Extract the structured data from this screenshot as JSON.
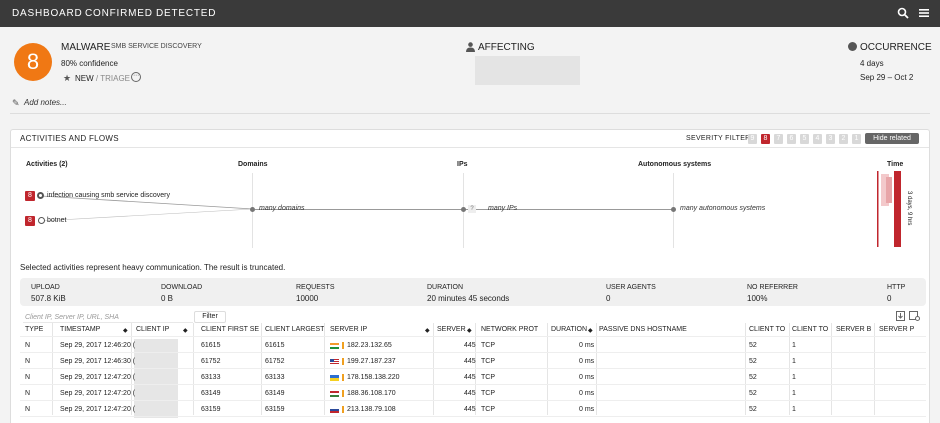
{
  "nav": {
    "tabs": [
      "DASHBOARD",
      "CONFIRMED",
      "DETECTED"
    ]
  },
  "header": {
    "risk_score": "8",
    "category": "MALWARE",
    "category_sub": "SMB SERVICE DISCOVERY",
    "confidence": "80% confidence",
    "status_new": "NEW",
    "status_sep": "/",
    "status_triage": "TRIAGE",
    "more_label": "⋯",
    "affecting_label": "AFFECTING",
    "occurrence_label": "OCCURRENCE",
    "occurrence_days": "4 days",
    "occurrence_range": "Sep 29 – Oct 2",
    "add_notes": "Add notes..."
  },
  "panel": {
    "title": "ACTIVITIES AND FLOWS",
    "severity_label": "SEVERITY FILTER:",
    "severity_levels": [
      "9",
      "8",
      "7",
      "6",
      "5",
      "4",
      "3",
      "2",
      "1"
    ],
    "severity_active": "8",
    "hide_related": "Hide related",
    "columns": {
      "activities": "Activities (2)",
      "domains": "Domains",
      "ips": "IPs",
      "asys": "Autonomous systems",
      "time": "Time"
    },
    "activities": [
      {
        "score": "8",
        "label": "infection causing smb service discovery",
        "selected": true
      },
      {
        "score": "8",
        "label": "botnet",
        "selected": false
      }
    ],
    "flow": {
      "domains": "many domains",
      "ip_count": "?",
      "ips": "many IPs",
      "asys": "many autonomous systems"
    },
    "time_label": "3 days, 9 hrs",
    "truncated_msg": "Selected activities represent heavy communication. The result is truncated."
  },
  "summary": [
    {
      "label": "UPLOAD",
      "value": "507.8 KiB"
    },
    {
      "label": "DOWNLOAD",
      "value": "0 B"
    },
    {
      "label": "REQUESTS",
      "value": "10000"
    },
    {
      "label": "DURATION",
      "value": "20 minutes 45 seconds"
    },
    {
      "label": "USER AGENTS",
      "value": "0"
    },
    {
      "label": "NO REFERRER",
      "value": "100%"
    },
    {
      "label": "HTTP",
      "value": "0"
    }
  ],
  "filter": {
    "placeholder": "Client IP, Server IP, URL, SHA",
    "button": "Filter"
  },
  "table": {
    "headers": [
      "TYPE",
      "TIMESTAMP",
      "CLIENT IP",
      "CLIENT FIRST SE",
      "CLIENT LARGEST",
      "SERVER IP",
      "SERVER",
      "NETWORK PROT",
      "DURATION",
      "PASSIVE DNS HOSTNAME",
      "CLIENT TO",
      "CLIENT TO",
      "SERVER B",
      "SERVER P"
    ],
    "rows": [
      {
        "type": "N",
        "timestamp": "Sep 29, 2017 12:46:20 (",
        "first": "61615",
        "largest": "61615",
        "flag": "in",
        "server_ip": "182.23.132.65",
        "port": "445",
        "proto": "TCP",
        "duration": "0 ms",
        "c1": "52",
        "c2": "1"
      },
      {
        "type": "N",
        "timestamp": "Sep 29, 2017 12:46:30 (",
        "first": "61752",
        "largest": "61752",
        "flag": "us",
        "server_ip": "199.27.187.237",
        "port": "445",
        "proto": "TCP",
        "duration": "0 ms",
        "c1": "52",
        "c2": "1"
      },
      {
        "type": "N",
        "timestamp": "Sep 29, 2017 12:47:20 (",
        "first": "63133",
        "largest": "63133",
        "flag": "ua",
        "server_ip": "178.158.138.220",
        "port": "445",
        "proto": "TCP",
        "duration": "0 ms",
        "c1": "52",
        "c2": "1"
      },
      {
        "type": "N",
        "timestamp": "Sep 29, 2017 12:47:20 (",
        "first": "63149",
        "largest": "63149",
        "flag": "hu",
        "server_ip": "188.36.108.170",
        "port": "445",
        "proto": "TCP",
        "duration": "0 ms",
        "c1": "52",
        "c2": "1"
      },
      {
        "type": "N",
        "timestamp": "Sep 29, 2017 12:47:20 (",
        "first": "63159",
        "largest": "63159",
        "flag": "ru",
        "server_ip": "213.138.79.108",
        "port": "445",
        "proto": "TCP",
        "duration": "0 ms",
        "c1": "52",
        "c2": "1"
      }
    ]
  },
  "colors": {
    "accent_orange": "#f07814",
    "severity_red": "#c0262d",
    "nav_bg": "#3a3a3a"
  },
  "icons": {
    "search": "search-icon",
    "menu": "menu-icon",
    "affecting": "user-icon",
    "occurrence": "clock-icon",
    "notes": "pencil-icon",
    "star": "star-icon"
  }
}
